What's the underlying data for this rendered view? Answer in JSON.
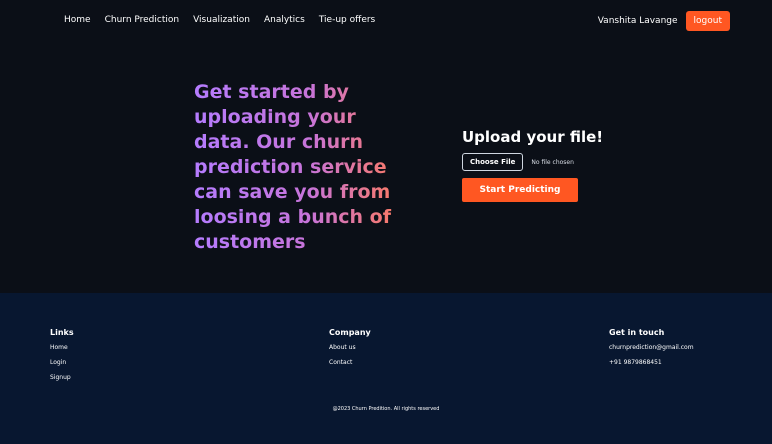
{
  "nav": {
    "items": [
      "Home",
      "Churn Prediction",
      "Visualization",
      "Analytics",
      "Tie-up offers"
    ],
    "user_name": "Vanshita Lavange",
    "logout_label": "logout"
  },
  "hero": {
    "text": "Get started by uploading your data. Our churn prediction service can save you from loosing a bunch of customers"
  },
  "upload": {
    "title": "Upload your file!",
    "choose_label": "Choose File",
    "file_status": "No file chosen",
    "start_label": "Start Predicting"
  },
  "footer": {
    "links": {
      "heading": "Links",
      "items": [
        "Home",
        "Login",
        "Signup"
      ]
    },
    "company": {
      "heading": "Company",
      "items": [
        "About us",
        "Contact"
      ]
    },
    "contact": {
      "heading": "Get in touch",
      "email": "churnprediction@gmail.com",
      "phone": "+91 9879868451"
    },
    "copyright": "@2023 Churn Predition. All rights reserved"
  },
  "colors": {
    "accent": "#ff5722",
    "background": "#0b0f17",
    "footer": "#081730",
    "gradient_start": "#b57cff",
    "gradient_end": "#ff7a5c"
  }
}
